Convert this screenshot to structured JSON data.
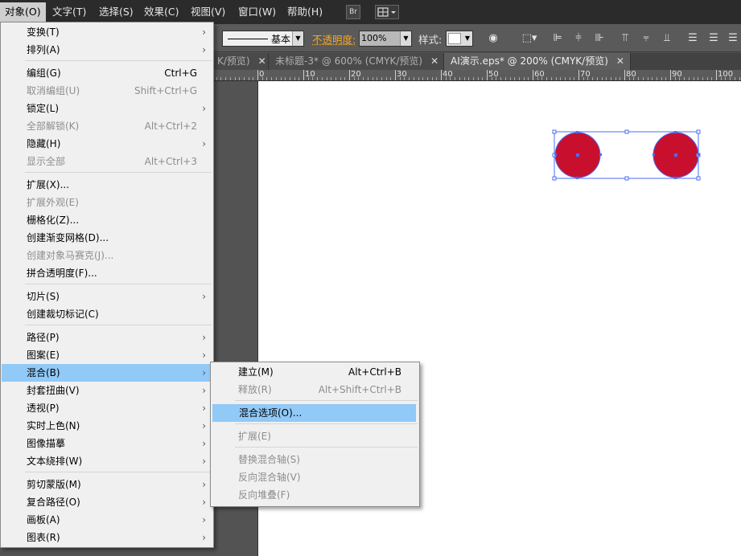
{
  "menubar": {
    "items": [
      "对象(O)",
      "文字(T)",
      "选择(S)",
      "效果(C)",
      "视图(V)",
      "窗口(W)",
      "帮助(H)"
    ],
    "br_label": "Br"
  },
  "controlbar": {
    "stroke_profile": "基本",
    "opacity_label": "不透明度:",
    "opacity_value": "100%",
    "style_label": "样式:"
  },
  "tabs": [
    {
      "label": "K/预览)",
      "active": false
    },
    {
      "label": "未标题-3* @ 600% (CMYK/预览)",
      "active": false
    },
    {
      "label": "AI演示.eps* @ 200% (CMYK/预览)",
      "active": true
    }
  ],
  "ruler": {
    "labels": [
      "0",
      "10",
      "20",
      "30",
      "40",
      "50",
      "60",
      "70",
      "80",
      "90",
      "100"
    ]
  },
  "object_menu": {
    "items": [
      {
        "label": "变换(T)",
        "shortcut": "",
        "submenu": true,
        "disabled": false
      },
      {
        "label": "排列(A)",
        "shortcut": "",
        "submenu": true,
        "disabled": false
      },
      {
        "label": "编组(G)",
        "shortcut": "Ctrl+G",
        "submenu": false,
        "disabled": false
      },
      {
        "label": "取消编组(U)",
        "shortcut": "Shift+Ctrl+G",
        "submenu": false,
        "disabled": true
      },
      {
        "label": "锁定(L)",
        "shortcut": "",
        "submenu": true,
        "disabled": false
      },
      {
        "label": "全部解锁(K)",
        "shortcut": "Alt+Ctrl+2",
        "submenu": false,
        "disabled": true
      },
      {
        "label": "隐藏(H)",
        "shortcut": "",
        "submenu": true,
        "disabled": false
      },
      {
        "label": "显示全部",
        "shortcut": "Alt+Ctrl+3",
        "submenu": false,
        "disabled": true
      },
      {
        "label": "扩展(X)...",
        "shortcut": "",
        "submenu": false,
        "disabled": false
      },
      {
        "label": "扩展外观(E)",
        "shortcut": "",
        "submenu": false,
        "disabled": true
      },
      {
        "label": "栅格化(Z)...",
        "shortcut": "",
        "submenu": false,
        "disabled": false
      },
      {
        "label": "创建渐变网格(D)...",
        "shortcut": "",
        "submenu": false,
        "disabled": false
      },
      {
        "label": "创建对象马赛克(J)...",
        "shortcut": "",
        "submenu": false,
        "disabled": true
      },
      {
        "label": "拼合透明度(F)...",
        "shortcut": "",
        "submenu": false,
        "disabled": false
      },
      {
        "label": "切片(S)",
        "shortcut": "",
        "submenu": true,
        "disabled": false
      },
      {
        "label": "创建裁切标记(C)",
        "shortcut": "",
        "submenu": false,
        "disabled": false
      },
      {
        "label": "路径(P)",
        "shortcut": "",
        "submenu": true,
        "disabled": false
      },
      {
        "label": "图案(E)",
        "shortcut": "",
        "submenu": true,
        "disabled": false
      },
      {
        "label": "混合(B)",
        "shortcut": "",
        "submenu": true,
        "disabled": false
      },
      {
        "label": "封套扭曲(V)",
        "shortcut": "",
        "submenu": true,
        "disabled": false
      },
      {
        "label": "透视(P)",
        "shortcut": "",
        "submenu": true,
        "disabled": false
      },
      {
        "label": "实时上色(N)",
        "shortcut": "",
        "submenu": true,
        "disabled": false
      },
      {
        "label": "图像描摹",
        "shortcut": "",
        "submenu": true,
        "disabled": false
      },
      {
        "label": "文本绕排(W)",
        "shortcut": "",
        "submenu": true,
        "disabled": false
      },
      {
        "label": "剪切蒙版(M)",
        "shortcut": "",
        "submenu": true,
        "disabled": false
      },
      {
        "label": "复合路径(O)",
        "shortcut": "",
        "submenu": true,
        "disabled": false
      },
      {
        "label": "画板(A)",
        "shortcut": "",
        "submenu": true,
        "disabled": false
      },
      {
        "label": "图表(R)",
        "shortcut": "",
        "submenu": true,
        "disabled": false
      }
    ]
  },
  "blend_menu": {
    "items": [
      {
        "label": "建立(M)",
        "shortcut": "Alt+Ctrl+B",
        "disabled": false
      },
      {
        "label": "释放(R)",
        "shortcut": "Alt+Shift+Ctrl+B",
        "disabled": true
      },
      {
        "label": "混合选项(O)...",
        "shortcut": "",
        "disabled": false
      },
      {
        "label": "扩展(E)",
        "shortcut": "",
        "disabled": true
      },
      {
        "label": "替换混合轴(S)",
        "shortcut": "",
        "disabled": true
      },
      {
        "label": "反向混合轴(V)",
        "shortcut": "",
        "disabled": true
      },
      {
        "label": "反向堆叠(F)",
        "shortcut": "",
        "disabled": true
      }
    ]
  },
  "colors": {
    "circle_fill": "#c8102e",
    "selection": "#4a6cf7",
    "highlight": "#91c9f7",
    "opacity_label": "#f5a623"
  }
}
